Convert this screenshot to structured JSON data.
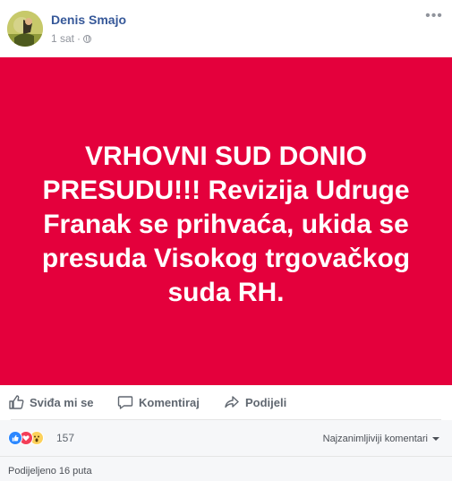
{
  "post": {
    "author": "Denis Smajo",
    "time": "1 sat",
    "separator": "·",
    "more_label": "•••",
    "text": "VRHOVNI SUD DONIO PRESUDU!!! Revizija Udruge Franak se prihvaća, ukida se presuda Visokog trgovačkog suda RH.",
    "background_color": "#e4003c"
  },
  "actions": {
    "like": "Sviđa mi se",
    "comment": "Komentiraj",
    "share": "Podijeli"
  },
  "reactions": {
    "icons": [
      "like-icon",
      "love-icon",
      "wow-icon"
    ],
    "count": "157",
    "sort_label": "Najzanimljiviji komentari"
  },
  "shares": {
    "text": "Podijeljeno 16 puta"
  }
}
